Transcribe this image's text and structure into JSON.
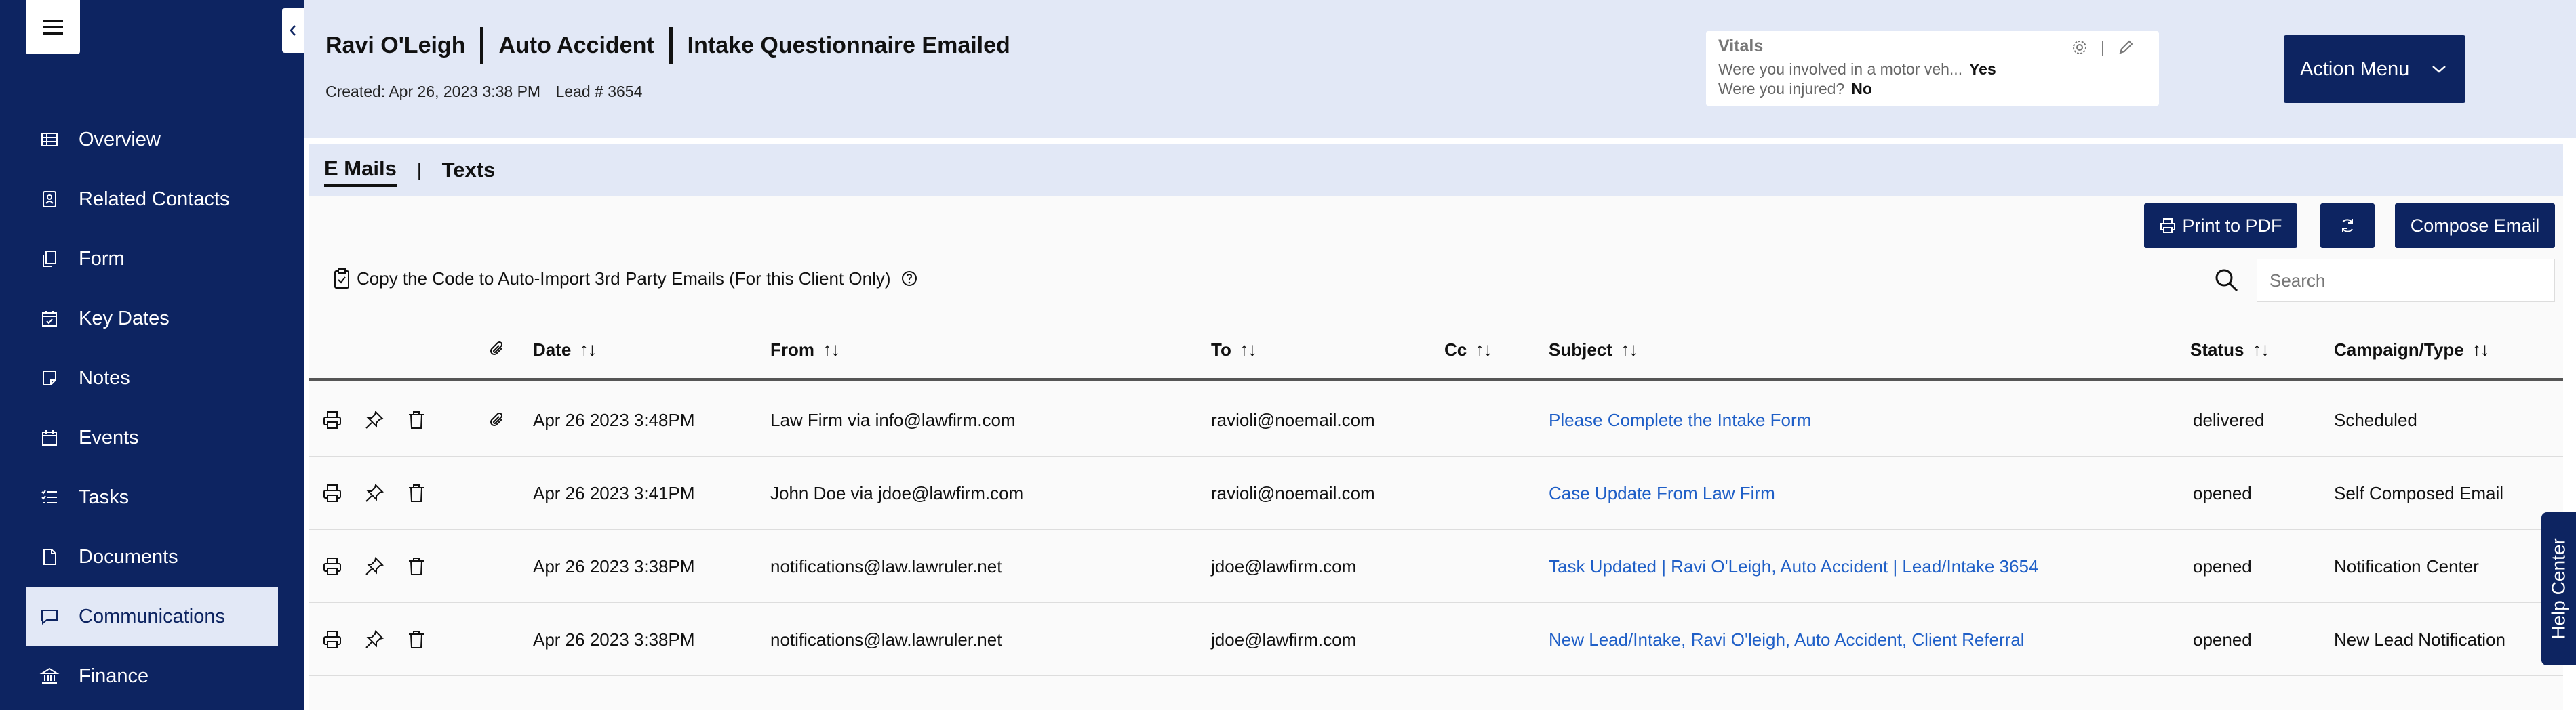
{
  "sidebar": {
    "items": [
      {
        "label": "Overview",
        "icon": "table-icon"
      },
      {
        "label": "Related Contacts",
        "icon": "contact-card-icon"
      },
      {
        "label": "Form",
        "icon": "form-copy-icon"
      },
      {
        "label": "Key Dates",
        "icon": "calendar-check-icon"
      },
      {
        "label": "Notes",
        "icon": "note-icon"
      },
      {
        "label": "Events",
        "icon": "calendar-icon"
      },
      {
        "label": "Tasks",
        "icon": "checklist-icon"
      },
      {
        "label": "Documents",
        "icon": "document-icon"
      },
      {
        "label": "Communications",
        "icon": "chat-icon",
        "active": true
      },
      {
        "label": "Finance",
        "icon": "bank-icon"
      }
    ]
  },
  "header": {
    "client_name": "Ravi O'Leigh",
    "case_type": "Auto Accident",
    "status": "Intake Questionnaire Emailed",
    "created": "Created: Apr 26, 2023 3:38 PM",
    "lead": "Lead # 3654"
  },
  "vitals": {
    "title": "Vitals",
    "q1": "Were you involved in a motor veh...",
    "a1": "Yes",
    "q2": "Were you injured?",
    "a2": "No"
  },
  "action_menu": {
    "label": "Action Menu"
  },
  "tabs": {
    "emails": "E Mails",
    "separator": "|",
    "texts": "Texts"
  },
  "toolbar": {
    "print_label": "Print to PDF",
    "compose_label": "Compose Email",
    "copy_code_label": "Copy the Code to Auto-Import 3rd Party Emails (For this Client Only)",
    "search_placeholder": "Search"
  },
  "table": {
    "sort_glyph": "↑↓",
    "columns": {
      "date": "Date",
      "from": "From",
      "to": "To",
      "cc": "Cc",
      "subject": "Subject",
      "status": "Status",
      "campaign": "Campaign/Type"
    },
    "rows": [
      {
        "date": "Apr 26 2023 3:48PM",
        "from": "Law Firm via info@lawfirm.com",
        "to": "ravioli@noemail.com",
        "cc": "",
        "subject": "Please Complete the Intake Form",
        "status": "delivered",
        "campaign": "Scheduled",
        "attachment": true
      },
      {
        "date": "Apr 26 2023 3:41PM",
        "from": "John Doe via jdoe@lawfirm.com",
        "to": "ravioli@noemail.com",
        "cc": "",
        "subject": "Case Update From Law Firm",
        "status": "opened",
        "campaign": "Self Composed Email",
        "attachment": false
      },
      {
        "date": "Apr 26 2023 3:38PM",
        "from": "notifications@law.lawruler.net",
        "to": "jdoe@lawfirm.com",
        "cc": "",
        "subject": "Task Updated | Ravi O'Leigh, Auto Accident | Lead/Intake 3654",
        "status": "opened",
        "campaign": "Notification Center",
        "attachment": false
      },
      {
        "date": "Apr 26 2023 3:38PM",
        "from": "notifications@law.lawruler.net",
        "to": "jdoe@lawfirm.com",
        "cc": "",
        "subject": "New Lead/Intake, Ravi O'leigh, Auto Accident, Client Referral",
        "status": "opened",
        "campaign": "New Lead Notification",
        "attachment": false
      }
    ]
  },
  "help_center": {
    "label": "Help Center"
  },
  "colors": {
    "navy": "#0d2461",
    "header_bg": "#e2e8f6",
    "link": "#1f5fc7"
  }
}
